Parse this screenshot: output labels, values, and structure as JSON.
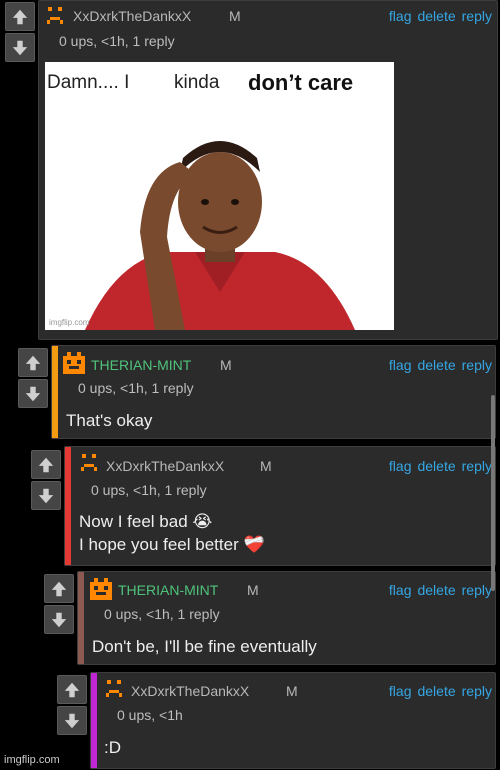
{
  "comments": [
    {
      "username": "XxDxrkTheDankxX",
      "mod_badge": "M",
      "meta": "0 ups, <1h, 1 reply",
      "meme_caption_left": "Damn.... I",
      "meme_caption_mid": "kinda",
      "meme_caption_bold": "don’t care",
      "meme_watermark": "imgflip.com",
      "actions": {
        "flag": "flag",
        "delete": "delete",
        "reply": "reply"
      }
    },
    {
      "username": "THERIAN-MINT",
      "mod_badge": "M",
      "meta": "0 ups, <1h, 1 reply",
      "text": "That's okay",
      "accent": "#f39c12",
      "actions": {
        "flag": "flag",
        "delete": "delete",
        "reply": "reply"
      }
    },
    {
      "username": "XxDxrkTheDankxX",
      "mod_badge": "M",
      "meta": "0 ups, <1h, 1 reply",
      "text_line1": "Now I feel bad 😭",
      "text_line2": "I hope you feel better ❤️‍🩹",
      "accent": "#e53935",
      "actions": {
        "flag": "flag",
        "delete": "delete",
        "reply": "reply"
      }
    },
    {
      "username": "THERIAN-MINT",
      "mod_badge": "M",
      "meta": "0 ups, <1h, 1 reply",
      "text": "Don't be, I'll be fine eventually",
      "accent": "#8d5a52",
      "actions": {
        "flag": "flag",
        "delete": "delete",
        "reply": "reply"
      }
    },
    {
      "username": "XxDxrkTheDankxX",
      "mod_badge": "M",
      "meta": "0 ups, <1h",
      "text": ":D",
      "accent": "#c026d3",
      "actions": {
        "flag": "flag",
        "delete": "delete",
        "reply": "reply"
      }
    }
  ],
  "watermark": "imgflip.com",
  "colors": {
    "link": "#35a6e3",
    "mint": "#4fc37b",
    "avatar": "#ff8800"
  }
}
